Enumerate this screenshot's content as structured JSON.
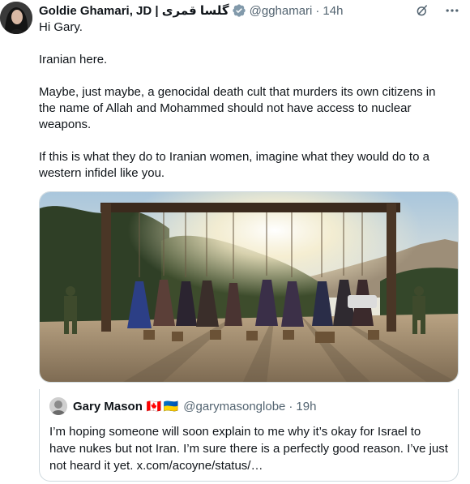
{
  "tweet": {
    "display_name": "Goldie Ghamari, JD | گلسا قمری",
    "handle": "@gghamari",
    "separator": "·",
    "time": "14h",
    "paragraphs": [
      "Hi Gary.",
      "Iranian here.",
      "Maybe, just maybe, a genocidal death cult that murders its own citizens in the name of Allah and Mohammed should not have access to nuclear weapons.",
      "If this is what they do to Iranian women, imagine what they would do to a western infidel like you."
    ],
    "icons": {
      "avatar": "avatar",
      "verified": "verified-badge-icon",
      "grok": "grok-icon",
      "more": "more-icon"
    }
  },
  "quoted_tweet": {
    "display_name": "Gary Mason",
    "flags": [
      "🇨🇦",
      "🇺🇦"
    ],
    "handle": "@garymasonglobe",
    "separator": "·",
    "time": "19h",
    "text": "I’m hoping someone will soon explain to me why it’s okay for Israel to have nukes but not Iran. I’m sure there is a perfectly good reason. I’ve just not heard it yet. x.com/acoyne/status/…"
  },
  "colors": {
    "text_primary": "#0f1419",
    "text_secondary": "#536471",
    "border": "#cfd9de",
    "verified": "#829aab"
  }
}
